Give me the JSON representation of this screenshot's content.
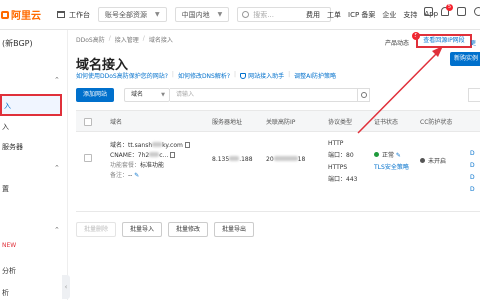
{
  "topbar": {
    "logo": "阿里云",
    "workbench": "工作台",
    "account_dropdown": "账号全部资源",
    "region_dropdown": "中国内地",
    "search_placeholder": "搜索...",
    "links": [
      "费用",
      "工单",
      "ICP 备案",
      "企业",
      "支持",
      "App"
    ],
    "bell_badge": "5"
  },
  "sidebar": {
    "title": "(新BGP)",
    "items": [
      {
        "label": "入"
      },
      {
        "label": "入"
      },
      {
        "label": "服务器"
      },
      {
        "label": "置"
      },
      {
        "label": "NEW"
      },
      {
        "label": "分析"
      },
      {
        "label": "析"
      }
    ],
    "active_label": "入"
  },
  "breadcrumb": [
    "DDoS高防",
    "接入管理",
    "域名接入"
  ],
  "page": {
    "title": "域名接入",
    "help_links": [
      "如何使用DDoS高防保护您的网站?",
      "如何修改DNS解析?",
      "网站接入助手",
      "调整AI防护策略"
    ],
    "product_dynamics": "产品动态",
    "product_dynamics_badge": "5",
    "view_ip_link": "查看回源IP网段",
    "more_link": "更",
    "buy_button": "新购实例"
  },
  "toolbar": {
    "add_button": "添加网站",
    "filter_select": "域名",
    "filter_placeholder": "请输入"
  },
  "table": {
    "headers": [
      "域名",
      "服务器地址",
      "关联高防IP",
      "协议类型",
      "证书状态",
      "CC防护状态"
    ],
    "row": {
      "domain_label": "域名：",
      "domain_value": "tt.sansh",
      "domain_value_tail": "ky.com",
      "cname_label": "CNAME：",
      "cname_value": "7h2",
      "cname_value_tail": "c...",
      "func_label": "功能套餐：",
      "func_value": "标准功能",
      "remark_label": "备注：",
      "remark_value": "--",
      "server_addr_head": "8.135",
      "server_addr_tail": ".188",
      "ip_head": "20",
      "ip_tail": "18",
      "http_label": "HTTP",
      "http_port": "端口：80",
      "https_label": "HTTPS",
      "https_port": "端口：443",
      "cert_status": "正常",
      "cert_policy": "TLS安全策略",
      "cc_status": "未开启"
    }
  },
  "bottom_buttons": [
    "批量删除",
    "批量导入",
    "批量修改",
    "批量导出"
  ]
}
